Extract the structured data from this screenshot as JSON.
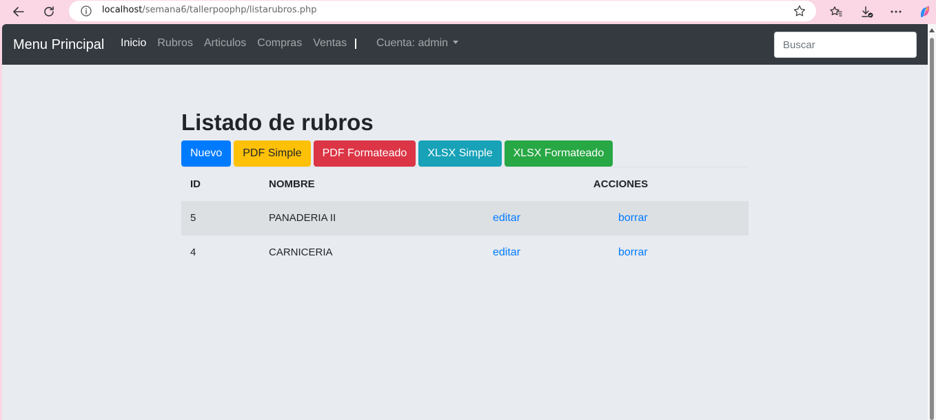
{
  "browser": {
    "url_host": "localhost",
    "url_path": "/semana6/tallerpoophp/listarubros.php"
  },
  "navbar": {
    "brand": "Menu Principal",
    "links": [
      "Inicio",
      "Rubros",
      "Articulos",
      "Compras",
      "Ventas"
    ],
    "account": "Cuenta: admin",
    "search_placeholder": "Buscar"
  },
  "page": {
    "title": "Listado de rubros",
    "buttons": {
      "nuevo": "Nuevo",
      "pdf_simple": "PDF Simple",
      "pdf_formateado": "PDF Formateado",
      "xlsx_simple": "XLSX Simple",
      "xlsx_formateado": "XLSX Formateado"
    }
  },
  "table": {
    "headers": {
      "id": "ID",
      "nombre": "NOMBRE",
      "acciones": "ACCIONES"
    },
    "rows": [
      {
        "id": "5",
        "nombre": "PANADERIA II",
        "editar": "editar",
        "borrar": "borrar"
      },
      {
        "id": "4",
        "nombre": "CARNICERIA",
        "editar": "editar",
        "borrar": "borrar"
      }
    ]
  },
  "colors": {
    "navbar": "#343a40",
    "primary": "#007bff",
    "warning": "#ffc107",
    "danger": "#dc3545",
    "info": "#17a2b8",
    "success": "#28a745",
    "chrome": "#fbd6e4"
  }
}
